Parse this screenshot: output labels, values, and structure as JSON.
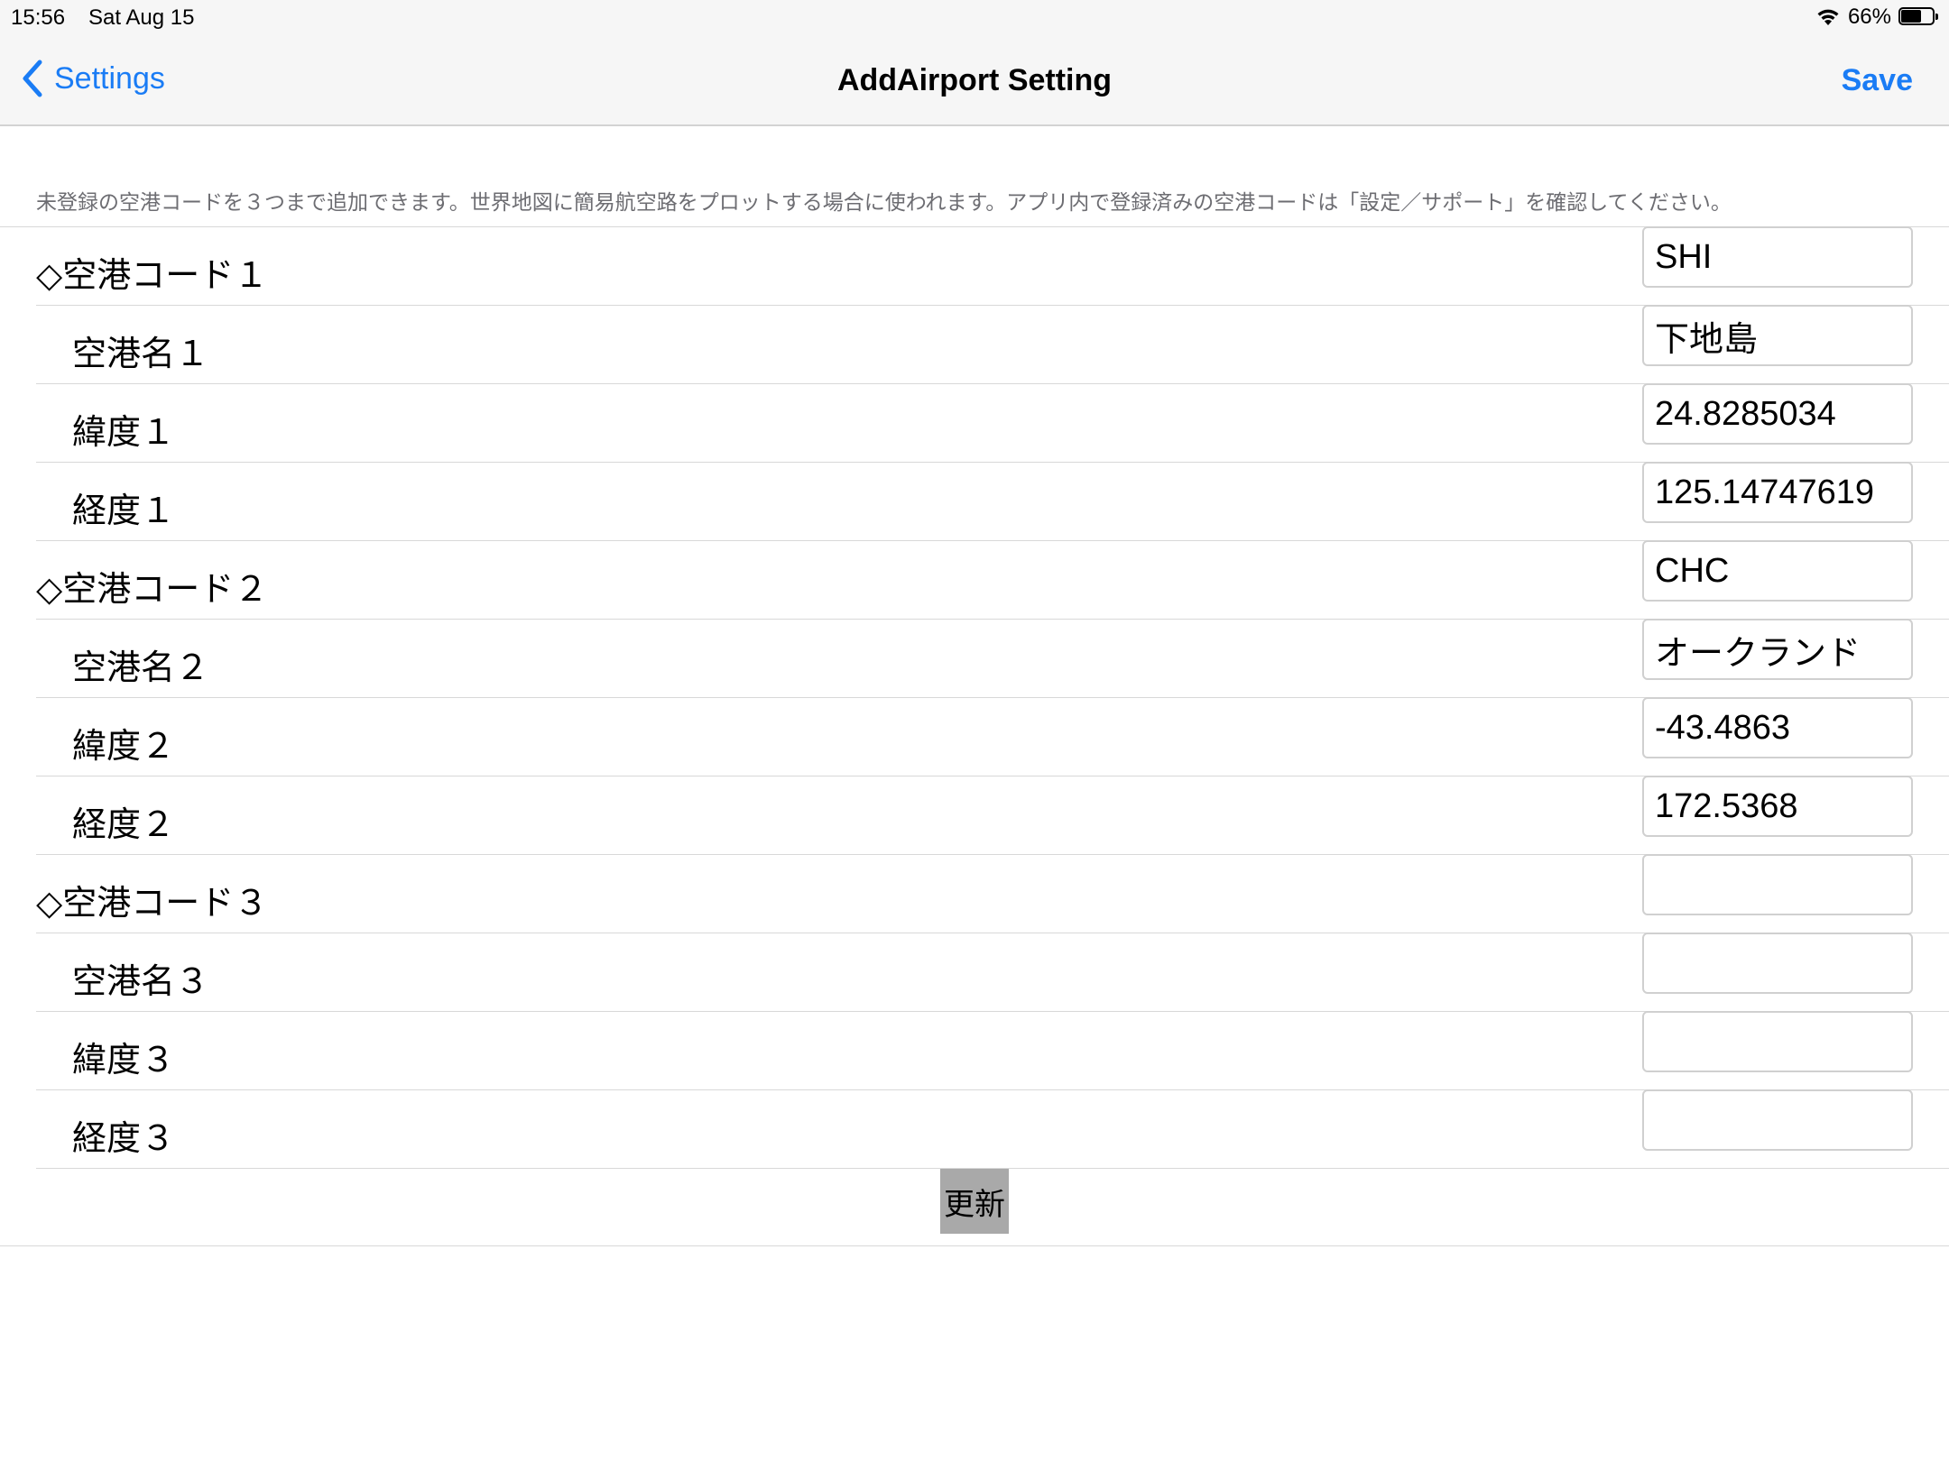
{
  "status_bar": {
    "time": "15:56",
    "date": "Sat Aug 15",
    "battery_percent": "66%",
    "battery_level": 0.66
  },
  "nav": {
    "back_label": "Settings",
    "title": "AddAirport Setting",
    "save_label": "Save",
    "accent_color": "#1a7cf5"
  },
  "description": "未登録の空港コードを３つまで追加できます。世界地図に簡易航空路をプロットする場合に使われます。アプリ内で登録済みの空港コードは「設定／サポート」を確認してください。",
  "rows": [
    {
      "label": "◇空港コード１",
      "value": "SHI"
    },
    {
      "label": "空港名１",
      "value": "下地島"
    },
    {
      "label": "緯度１",
      "value": "24.8285034"
    },
    {
      "label": "経度１",
      "value": "125.14747619"
    },
    {
      "label": "◇空港コード２",
      "value": "CHC"
    },
    {
      "label": "空港名２",
      "value": "オークランド"
    },
    {
      "label": "緯度２",
      "value": "-43.4863"
    },
    {
      "label": "経度２",
      "value": "172.5368"
    },
    {
      "label": "◇空港コード３",
      "value": ""
    },
    {
      "label": "空港名３",
      "value": ""
    },
    {
      "label": "緯度３",
      "value": ""
    },
    {
      "label": "経度３",
      "value": ""
    }
  ],
  "update_label": "更新"
}
